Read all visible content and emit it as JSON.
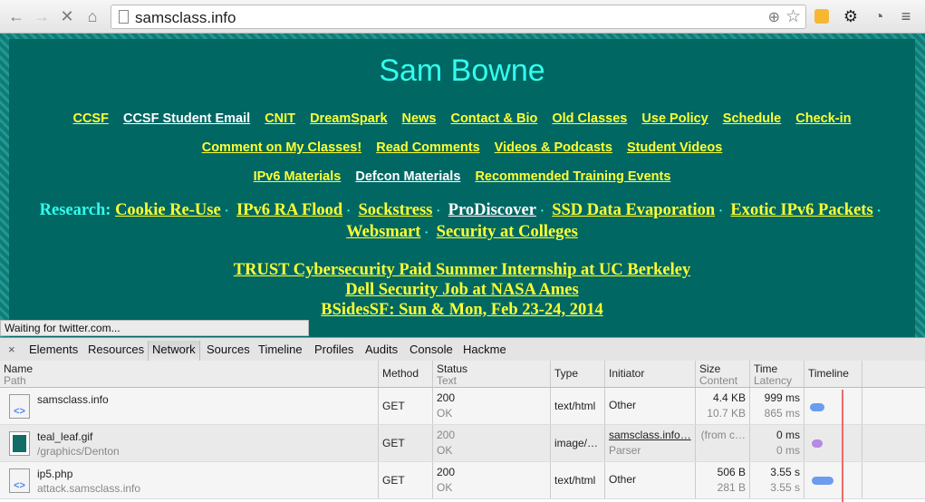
{
  "browser": {
    "url": "samsclass.info",
    "status": "Waiting for twitter.com..."
  },
  "page": {
    "title": "Sam Bowne",
    "nav_rows": [
      [
        "CCSF",
        "CCSF Student Email",
        "CNIT",
        "DreamSpark",
        "News",
        "Contact & Bio",
        "Old Classes",
        "Use Policy",
        "Schedule",
        "Check-in"
      ],
      [
        "Comment on My Classes!",
        "Read Comments",
        "Videos & Podcasts",
        "Student Videos"
      ],
      [
        "IPv6 Materials",
        "Defcon Materials",
        "Recommended Training Events"
      ]
    ],
    "research_label": "Research:",
    "research": [
      "Cookie Re-Use",
      "IPv6 RA Flood",
      "Sockstress",
      "ProDiscover",
      "SSD Data Evaporation",
      "Exotic IPv6 Packets",
      "Websmart",
      "Security at Colleges"
    ],
    "separator": "·",
    "news": [
      "TRUST Cybersecurity Paid Summer Internship at UC Berkeley",
      "Dell Security Job at NASA Ames",
      "BSidesSF: Sun & Mon, Feb 23-24, 2014"
    ]
  },
  "devtools": {
    "close": "×",
    "tabs": [
      "Elements",
      "Resources",
      "Network",
      "Sources",
      "Timeline",
      "Profiles",
      "Audits",
      "Console",
      "Hackme"
    ],
    "active_tab": "Network",
    "columns": {
      "name": "Name",
      "path": "Path",
      "method": "Method",
      "status": "Status",
      "text": "Text",
      "type": "Type",
      "initiator": "Initiator",
      "size": "Size",
      "content": "Content",
      "time": "Time",
      "latency": "Latency",
      "timeline": "Timeline"
    },
    "rows": [
      {
        "name": "samsclass.info",
        "path": "",
        "method": "GET",
        "status": "200",
        "text": "OK",
        "type": "text/html",
        "initiator": "Other",
        "initiator_sub": "",
        "size": "4.4 KB",
        "content": "10.7 KB",
        "time": "999 ms",
        "latency": "865 ms"
      },
      {
        "name": "teal_leaf.gif",
        "path": "/graphics/Denton",
        "method": "GET",
        "status": "200",
        "text": "OK",
        "type": "image/…",
        "initiator": "samsclass.info…",
        "initiator_sub": "Parser",
        "size": "(from c…",
        "content": "",
        "time": "0 ms",
        "latency": "0 ms"
      },
      {
        "name": "ip5.php",
        "path": "attack.samsclass.info",
        "method": "GET",
        "status": "200",
        "text": "OK",
        "type": "text/html",
        "initiator": "Other",
        "initiator_sub": "",
        "size": "506 B",
        "content": "281 B",
        "time": "3.55 s",
        "latency": "3.55 s"
      }
    ]
  }
}
